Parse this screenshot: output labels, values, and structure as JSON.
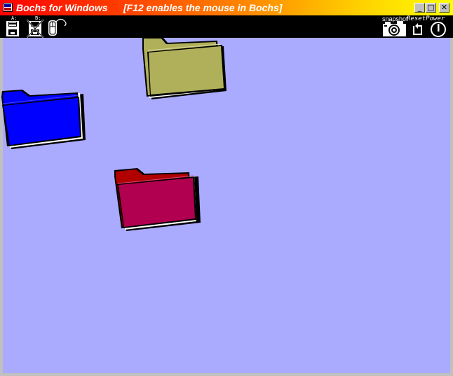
{
  "window": {
    "title": "Bochs for Windows",
    "hint": "[F12 enables the mouse in Bochs]"
  },
  "window_buttons": {
    "minimize": "_",
    "maximize": "□",
    "close": "✕"
  },
  "toolbar": {
    "floppy_a_label": "A:",
    "floppy_b_label": "B:",
    "snapshot_label": "snapshot",
    "resetpower_label": "ResetPower",
    "icons": [
      "floppy-a-icon",
      "floppy-b-icon",
      "mouse-icon",
      "snapshot-camera-icon",
      "reset-icon",
      "power-icon"
    ]
  },
  "desktop": {
    "background": "#aaaaff",
    "folders": [
      {
        "name": "olive-folder",
        "color": "#b0b05a"
      },
      {
        "name": "blue-folder",
        "color": "#0000ff"
      },
      {
        "name": "crimson-folder",
        "color": "#b0004f"
      }
    ]
  }
}
